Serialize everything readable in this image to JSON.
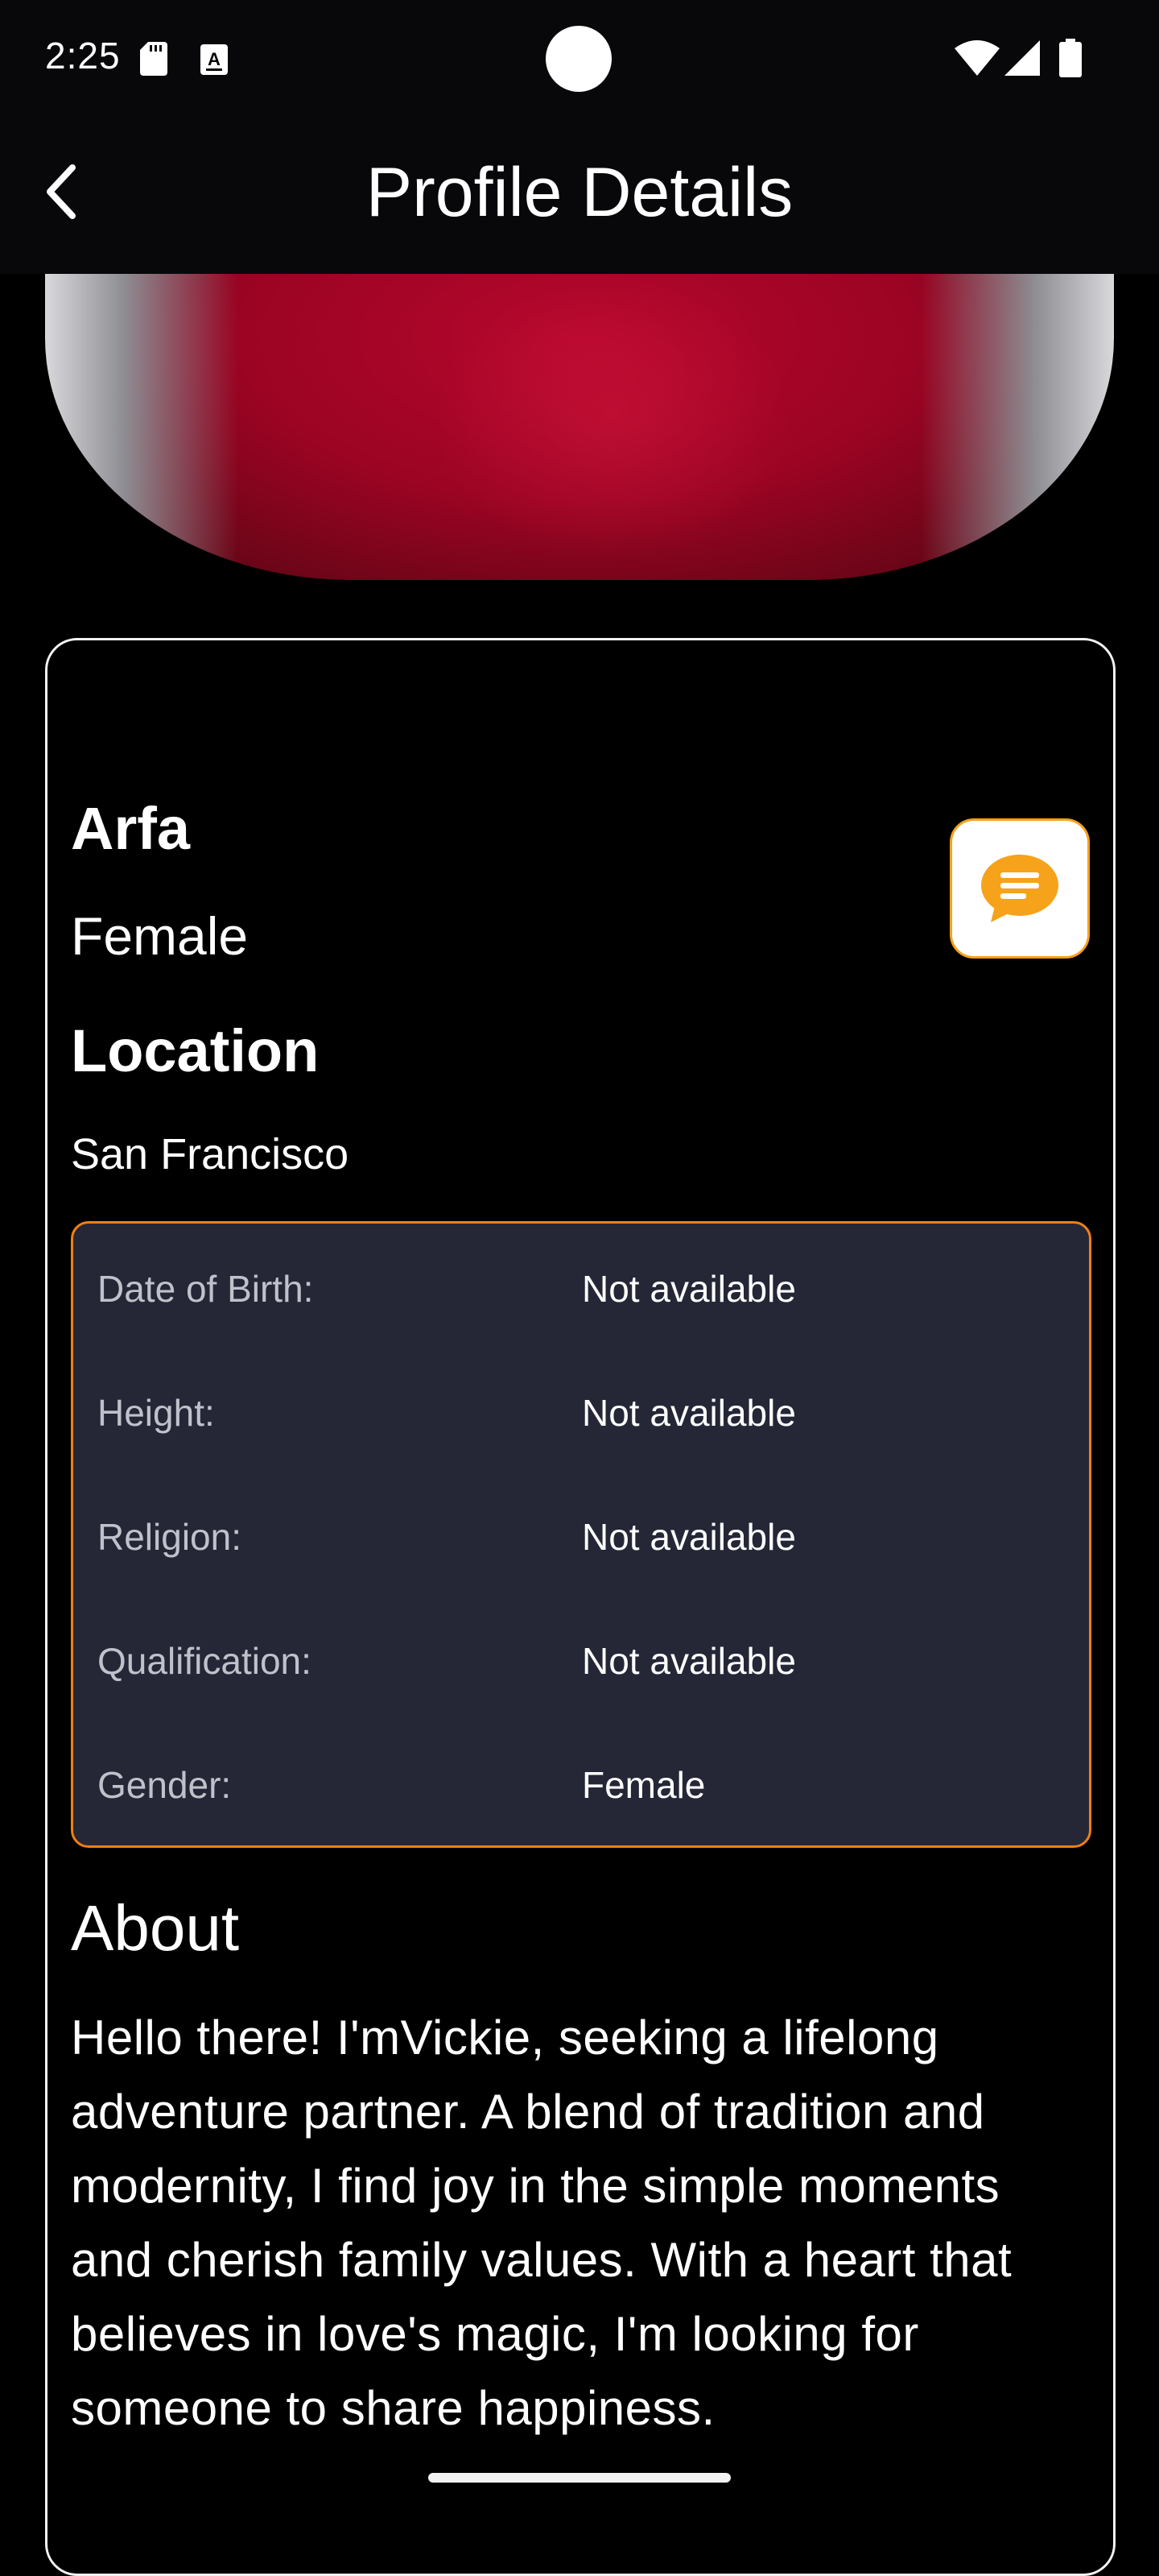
{
  "status_bar": {
    "time": "2:25",
    "icons": [
      "sd-card-icon",
      "keyboard-a-icon",
      "wifi-icon",
      "cell-signal-icon",
      "battery-icon"
    ]
  },
  "app_bar": {
    "title": "Profile Details",
    "back_icon": "chevron-left-icon"
  },
  "profile": {
    "name": "Arfa",
    "gender": "Female",
    "location_heading": "Location",
    "location": "San Francisco",
    "chat_icon": "chat-bubble-icon"
  },
  "details": [
    {
      "label": "Date of Birth:",
      "value": "Not available"
    },
    {
      "label": "Height:",
      "value": "Not available"
    },
    {
      "label": "Religion:",
      "value": "Not available"
    },
    {
      "label": "Qualification:",
      "value": "Not available"
    },
    {
      "label": "Gender:",
      "value": "Female"
    }
  ],
  "about": {
    "heading": "About",
    "lines": [
      "Hello there! I'mVickie, seeking a lifelong",
      "adventure partner. A blend of tradition and",
      "modernity, I find joy in the simple moments",
      "and cherish family values. With a heart that",
      "believes in love's magic, I'm looking for",
      "someone to share happiness."
    ]
  },
  "colors": {
    "background": "#000000",
    "app_bar": "#08080b",
    "accent_orange": "#f07f14",
    "chat_orange": "#f6a21a",
    "details_bg": "#252737",
    "label_gray": "#bfc1cb"
  }
}
